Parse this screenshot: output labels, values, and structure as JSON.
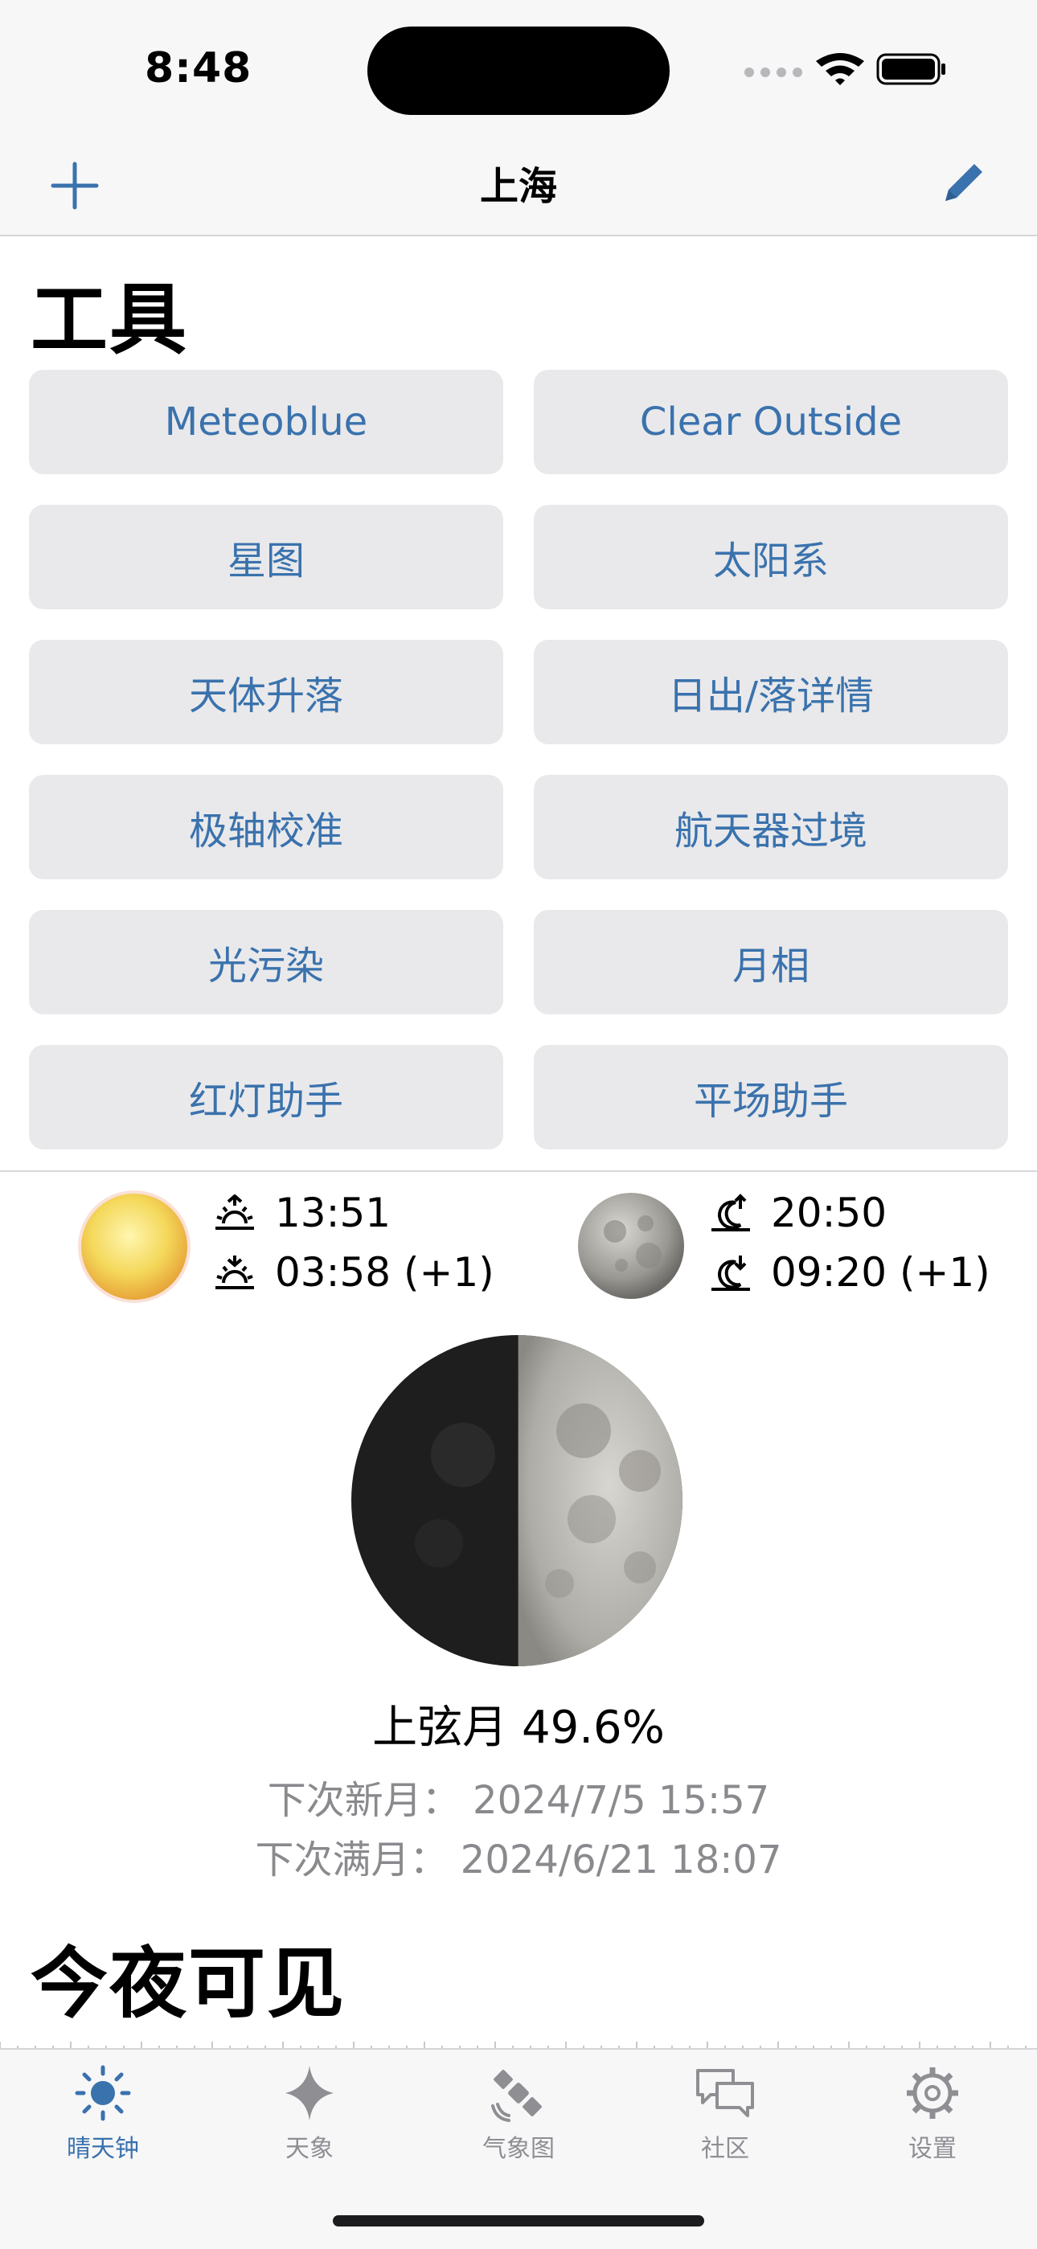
{
  "status_bar": {
    "time": "8:48"
  },
  "nav": {
    "title": "上海",
    "add_icon": "plus-icon",
    "edit_icon": "pencil-icon"
  },
  "tools": {
    "title": "工具",
    "buttons": [
      {
        "label": "Meteoblue"
      },
      {
        "label": "Clear Outside"
      },
      {
        "label": "星图"
      },
      {
        "label": "太阳系"
      },
      {
        "label": "天体升落"
      },
      {
        "label": "日出/落详情"
      },
      {
        "label": "极轴校准"
      },
      {
        "label": "航天器过境"
      },
      {
        "label": "光污染"
      },
      {
        "label": "月相"
      },
      {
        "label": "红灯助手"
      },
      {
        "label": "平场助手"
      }
    ]
  },
  "sun": {
    "rise": "13:51",
    "set": "03:58 (+1)"
  },
  "moon": {
    "rise": "20:50",
    "set": "09:20 (+1)"
  },
  "moon_phase": {
    "label": "上弦月 49.6%",
    "illumination_percent": 49.6,
    "next_new": "下次新月： 2024/7/5 15:57",
    "next_full": "下次满月： 2024/6/21 18:07"
  },
  "tonight": {
    "title": "今夜可见"
  },
  "tab_bar": {
    "tabs": [
      {
        "label": "晴天钟",
        "icon": "sun-icon",
        "active": true
      },
      {
        "label": "天象",
        "icon": "sparkle-icon",
        "active": false
      },
      {
        "label": "气象图",
        "icon": "satellite-icon",
        "active": false
      },
      {
        "label": "社区",
        "icon": "chat-bubbles-icon",
        "active": false
      },
      {
        "label": "设置",
        "icon": "gear-icon",
        "active": false
      }
    ]
  },
  "colors": {
    "accent": "#3a72ad",
    "button_bg": "#e9e9eb",
    "muted_text": "#8a8a8e"
  }
}
